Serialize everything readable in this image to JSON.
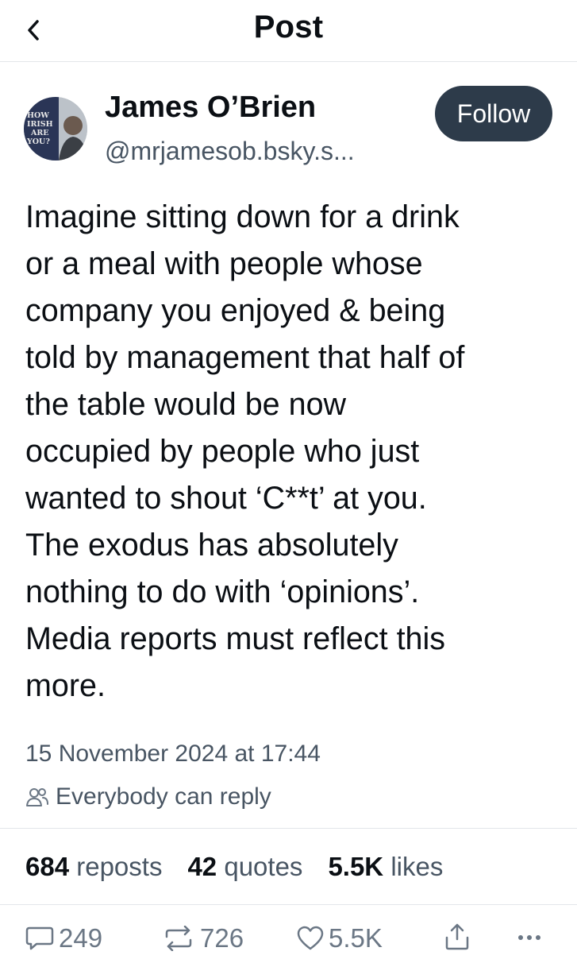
{
  "header": {
    "title": "Post"
  },
  "author": {
    "name": "James O’Brien",
    "handle": "@mrjamesob.bsky.s...",
    "avatar_text": [
      "HOW",
      "IRISH",
      "ARE",
      "YOU?"
    ]
  },
  "follow_label": "Follow",
  "post": {
    "text": "Imagine sitting down for a drink\nor a meal with people whose\ncompany you enjoyed & being\ntold by management that half of\nthe table would be now\noccupied by people who just\nwanted to shout ‘C**t’ at you.\nThe exodus has absolutely\nnothing to do with ‘opinions’.\nMedia reports must reflect this\nmore.",
    "timestamp": "15 November 2024 at 17:44",
    "reply_setting": "Everybody can reply"
  },
  "stats": {
    "reposts": {
      "count": "684",
      "label": "reposts"
    },
    "quotes": {
      "count": "42",
      "label": "quotes"
    },
    "likes": {
      "count": "5.5K",
      "label": "likes"
    }
  },
  "actions": {
    "reply_count": "249",
    "repost_count": "726",
    "like_count": "5.5K"
  },
  "icons": {
    "back": "chevron-left-icon",
    "reply_setting": "people-icon",
    "reply": "speech-bubble-icon",
    "repost": "repost-arrows-icon",
    "like": "heart-icon",
    "share": "share-icon",
    "more": "ellipsis-icon"
  },
  "colors": {
    "text": "#0b0f14",
    "muted": "#485563",
    "follow_bg": "#2d3b4a",
    "action_grey": "#6b7785"
  }
}
